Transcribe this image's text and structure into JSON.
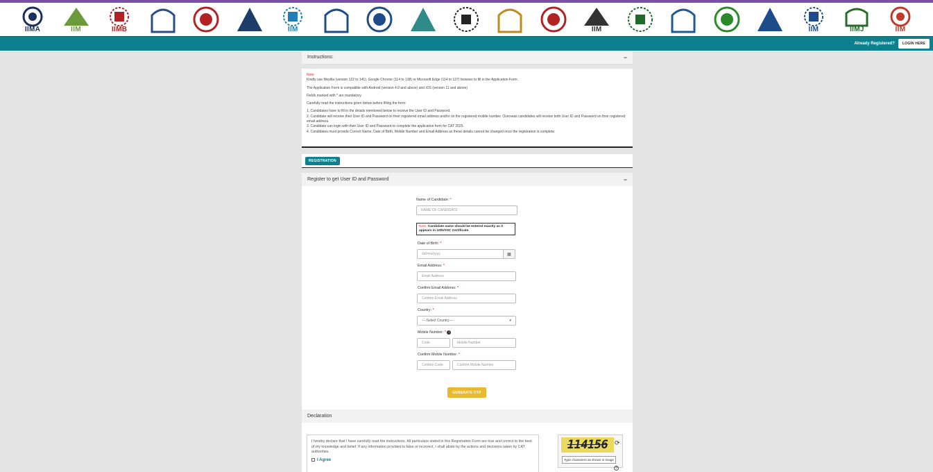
{
  "header": {
    "logos": [
      {
        "name": "iima-logo",
        "text": "IIMA",
        "color": "#1b2f5e"
      },
      {
        "name": "iim-lucknow-logo",
        "text": "IIM",
        "color": "#6a9a3a"
      },
      {
        "name": "iimb-logo",
        "text": "IIMB",
        "color": "#b22222"
      },
      {
        "name": "iim-calcutta-logo",
        "text": "",
        "color": "#2b4d8a"
      },
      {
        "name": "iim-kozhikode-logo",
        "text": "",
        "color": "#b22222"
      },
      {
        "name": "iim-indore-logo",
        "text": "",
        "color": "#1f3d6a"
      },
      {
        "name": "iim-shillong-logo",
        "text": "IIM",
        "color": "#1d7fb5"
      },
      {
        "name": "iim-ahmedabad-triangle-logo",
        "text": "",
        "color": "#1e4b8a"
      },
      {
        "name": "iim-rohtak-logo",
        "text": "",
        "color": "#1e4b8a"
      },
      {
        "name": "iim-trichy-logo",
        "text": "",
        "color": "#2f8a8a"
      },
      {
        "name": "iim-udaipur-logo",
        "text": "",
        "color": "#222222"
      },
      {
        "name": "iim-kashipur-logo",
        "text": "",
        "color": "#c08a1a"
      },
      {
        "name": "iim-raipur-logo",
        "text": "",
        "color": "#b22222"
      },
      {
        "name": "iim-ranchi-logo",
        "text": "IIM",
        "color": "#333333"
      },
      {
        "name": "iim-amritsar-logo",
        "text": "",
        "color": "#1e6b2a"
      },
      {
        "name": "iim-sambalpur-logo",
        "text": "",
        "color": "#1d5a9a"
      },
      {
        "name": "iim-bodhgaya-logo",
        "text": "",
        "color": "#2a8a2a"
      },
      {
        "name": "iim-nagpur-logo",
        "text": "",
        "color": "#1e4b8a"
      },
      {
        "name": "iim-sirmaur-logo",
        "text": "IIM",
        "color": "#1e4b8a"
      },
      {
        "name": "iim-jammu-logo",
        "text": "IIMJ",
        "color": "#2a6b2a"
      },
      {
        "name": "iim-vizag-logo",
        "text": "IIM",
        "color": "#c0392b"
      }
    ]
  },
  "nav": {
    "already_registered": "Already Registered?",
    "login_label": "LOGIN HERE"
  },
  "instructions": {
    "title": "Instructions:",
    "collapse": "−",
    "note_label": "Note:",
    "browser_note": "Kindly use Mozilla (version 122 to 141), Google Chrome (114 to 138) or Microsoft Edge (114 to 137) browser to fill in the Application Form.",
    "compat_note": "The Application Form is compatible with Android (version 4.0 and above) and iOS (version 11 and above)",
    "mandatory_note": "Fields marked with * are mandatory.",
    "read_note": "Carefully read the instructions given below before filling the form:",
    "items": [
      "1. Candidates have to fill in the details mentioned below to receive the User ID and Password.",
      "2. Candidate will receive their User ID and Password on their registered email address and/or on the registered mobile number. Overseas candidates will receive both User ID and Password on their registered email address.",
      "3. Candidate can login with their User ID and Password to complete the application form for CAT 2025.",
      "4. Candidates must provide Correct Name, Date of Birth, Mobile Number and Email Address as these details cannot be changed once the registration is complete."
    ]
  },
  "registration": {
    "tab_label": "REGISTRATION",
    "section_title": "Register to get User ID and Password",
    "collapse": "−",
    "name_label": "Name of Candidate:",
    "name_placeholder": "NAME OF CANDIDATE",
    "name_note_label": "Note:",
    "name_note_text": "Candidate name should be entered exactly as it appears in 10th/SSC Certificate.",
    "dob_label": "Date of Birth:",
    "dob_placeholder": "dd/mm/yyyy",
    "email_label": "Email Address:",
    "email_placeholder": "Email Address",
    "confirm_email_label": "Confirm Email Address:",
    "confirm_email_placeholder": "Confirm Email Address",
    "country_label": "Country:",
    "country_value": "----Select Country----",
    "mobile_label": "Mobile Number:",
    "code_placeholder": "Code",
    "mobile_placeholder": "Mobile Number",
    "confirm_mobile_label": "Confirm Mobile Number:",
    "confirm_code_placeholder": "Confirm Code",
    "confirm_mobile_placeholder": "Confirm Mobile Number",
    "required_mark": "*",
    "otp_button": "GENERATE OTP"
  },
  "declaration": {
    "title": "Declaration",
    "text": "I hereby declare that I have carefully read the instructions. All particulars stated in this Registration Form are true and correct to the best of my knowledge and belief. If any information provided is false or incorrect, I shall abide by the actions and decisions taken by CAT authorities.",
    "agree_label": "I Agree",
    "captcha_text": "114156",
    "captcha_placeholder": "Type characters as shown in image",
    "help": "?"
  },
  "colors": {
    "accent": "#0e7f8c",
    "otp": "#e8b830",
    "topline": "#7b4fa8",
    "required": "#d0021b"
  }
}
